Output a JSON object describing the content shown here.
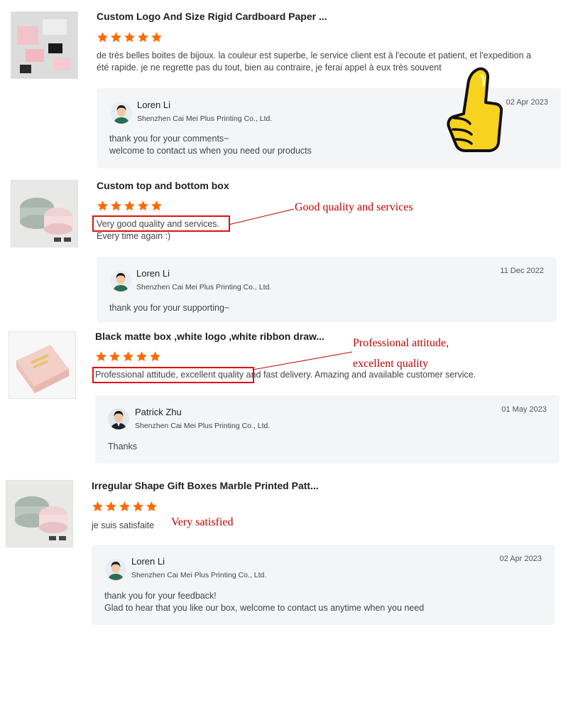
{
  "reviews": [
    {
      "title": "Custom Logo And Size Rigid Cardboard Paper ...",
      "rating": 5,
      "text": "de très belles boites de bijoux. la couleur est superbe, le service client est à l'ecoute et patient, et l'expedition a été rapide. je ne regrette pas du tout, bien au contraire, je ferai appel à eux très souvent",
      "reply": {
        "name": "Loren Li",
        "company": "Shenzhen Cai Mei Plus Printing Co., Ltd.",
        "date": "02 Apr 2023",
        "text_line1": "thank you for your comments~",
        "text_line2": "welcome to contact us when you need our products"
      }
    },
    {
      "title": "Custom top and bottom box",
      "rating": 5,
      "text_line1": "Very good quality and services.",
      "text_line2": "Every time again :)",
      "annotation": "Good quality and services",
      "reply": {
        "name": "Loren Li",
        "company": "Shenzhen Cai Mei Plus Printing Co., Ltd.",
        "date": "11 Dec 2022",
        "text_line1": "thank you for your supporting~"
      }
    },
    {
      "title": "Black matte box ,white logo ,white ribbon draw...",
      "rating": 5,
      "text_highlight": "Professional attitude, excellent quality",
      "text_rest": " and fast delivery. Amazing and available customer service.",
      "annotation_line1": "Professional attitude,",
      "annotation_line2": "excellent quality",
      "reply": {
        "name": "Patrick Zhu",
        "company": "Shenzhen Cai Mei Plus Printing Co., Ltd.",
        "date": "01 May 2023",
        "text_line1": "Thanks"
      }
    },
    {
      "title": "Irregular Shape Gift Boxes Marble Printed Patt...",
      "rating": 5,
      "text": "je suis satisfaite",
      "annotation": "Very satisfied",
      "reply": {
        "name": "Loren Li",
        "company": "Shenzhen Cai Mei Plus Printing Co., Ltd.",
        "date": "02 Apr 2023",
        "text_line1": "thank you for your feedback!",
        "text_line2": "Glad to hear that you like our box, welcome to contact us anytime when you need"
      }
    }
  ],
  "colors": {
    "star": "#ff6a00",
    "annotation": "#c00000",
    "highlight_box": "#e01010",
    "reply_bg": "#f4f5f7"
  },
  "icons": {
    "rating": "star-icon",
    "sticker": "thumbs-up-icon"
  }
}
